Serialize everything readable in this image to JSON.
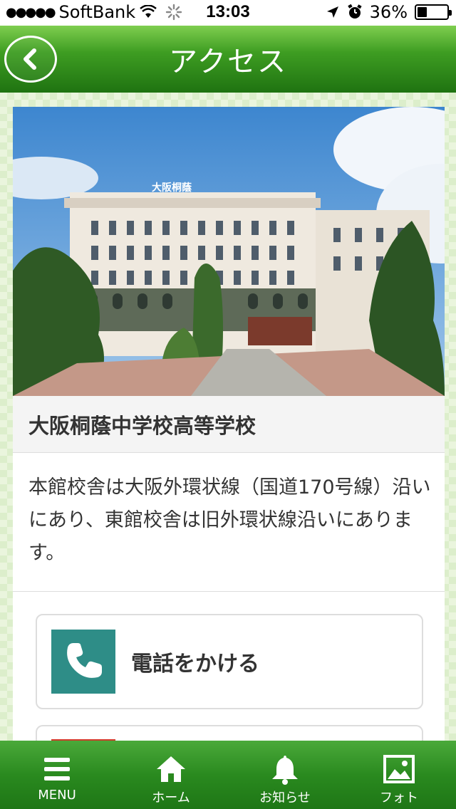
{
  "status_bar": {
    "signal_dots": "●●●●●",
    "carrier": "SoftBank",
    "time": "13:03",
    "battery": "36%"
  },
  "header": {
    "title": "アクセス",
    "back_icon": "chevron-left-icon"
  },
  "content": {
    "school_name": "大阪桐蔭中学校高等学校",
    "description": "本館校舎は大阪外環状線（国道170号線）沿いにあり、東館校舎は旧外環状線沿いにあります。",
    "call_button_label": "電話をかける"
  },
  "tab_bar": {
    "items": [
      {
        "label": "MENU",
        "icon": "hamburger-icon"
      },
      {
        "label": "ホーム",
        "icon": "home-icon"
      },
      {
        "label": "お知らせ",
        "icon": "bell-icon"
      },
      {
        "label": "フォト",
        "icon": "photo-icon"
      }
    ]
  },
  "colors": {
    "header_green": "#3e9d22",
    "call_icon_bg": "#2e8d87",
    "tab_green": "#2a8a1f"
  }
}
